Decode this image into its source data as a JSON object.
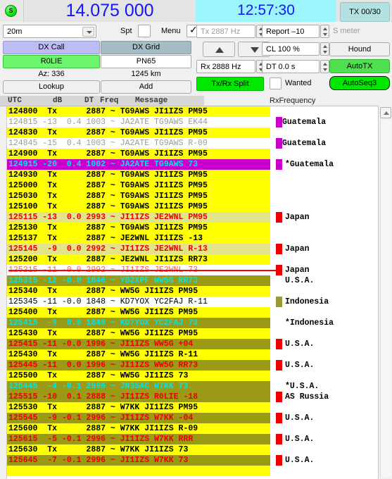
{
  "header": {
    "status_led": "S",
    "frequency": "14.075 000",
    "clock": "12:57:30",
    "tx_counter": "TX 00/30"
  },
  "controls": {
    "band": "20m",
    "spt_label": "Spt",
    "spt_checked": false,
    "menu_label": "Menu",
    "menu_checked": true,
    "dx_call_label": "DX Call",
    "dx_grid_label": "DX Grid",
    "dx_call_value": "R0LIE",
    "dx_grid_value": "PN65",
    "azimuth": "Az: 336",
    "distance": "1245 km",
    "lookup_label": "Lookup",
    "add_label": "Add",
    "tx_freq": "Tx  2887  Hz",
    "rx_freq": "Rx  2888  Hz",
    "up_arrow": "▲",
    "down_arrow": "▼",
    "report": "Report –10",
    "cl": "CL  100 %",
    "dt": "DT 0.0 s",
    "s_meter": "S meter",
    "hound": "Hound",
    "auto_tx": "AutoTX",
    "auto_seq": "AutoSeq3",
    "tx_rx_split": "Tx/Rx Split",
    "wanted_label": "Wanted",
    "wanted_checked": false
  },
  "table": {
    "columns": [
      "UTC",
      "dB",
      "DT",
      "Freq",
      "Message"
    ],
    "rx_frequency_label": "RxFrequency",
    "rows": [
      {
        "utc": "124800",
        "db": "Tx",
        "dt": "",
        "freq": "2887",
        "sep": "~",
        "msg": "TG9AWS JI1IZS PM95",
        "country": "",
        "style": "tx"
      },
      {
        "utc": "124815",
        "db": "-13",
        "dt": "0.4",
        "freq": "1003",
        "sep": "~",
        "msg": "JA2ATE TG9AWS EK44",
        "country": "Guatemala",
        "star": "^",
        "style": "gray",
        "mark": "#cc00cc"
      },
      {
        "utc": "124830",
        "db": "Tx",
        "dt": "",
        "freq": "2887",
        "sep": "~",
        "msg": "TG9AWS JI1IZS PM95",
        "country": "",
        "style": "tx"
      },
      {
        "utc": "124845",
        "db": "-15",
        "dt": "0.4",
        "freq": "1003",
        "sep": "~",
        "msg": "JA2ATE TG9AWS R-09",
        "country": "Guatemala",
        "star": "^",
        "style": "gray",
        "mark": "#cc00cc"
      },
      {
        "utc": "124900",
        "db": "Tx",
        "dt": "",
        "freq": "2887",
        "sep": "~",
        "msg": "TG9AWS JI1IZS PM95",
        "country": "",
        "style": "tx"
      },
      {
        "utc": "124915",
        "db": "-20",
        "dt": "0.4",
        "freq": "1002",
        "sep": "~",
        "msg": "JA2ATE TG9AWS 73",
        "country": "*Guatemala",
        "style": "magenta",
        "mark": "#cc00cc"
      },
      {
        "utc": "124930",
        "db": "Tx",
        "dt": "",
        "freq": "2887",
        "sep": "~",
        "msg": "TG9AWS JI1IZS PM95",
        "country": "",
        "style": "tx"
      },
      {
        "utc": "125000",
        "db": "Tx",
        "dt": "",
        "freq": "2887",
        "sep": "~",
        "msg": "TG9AWS JI1IZS PM95",
        "country": "",
        "style": "tx"
      },
      {
        "utc": "125030",
        "db": "Tx",
        "dt": "",
        "freq": "2887",
        "sep": "~",
        "msg": "TG9AWS JI1IZS PM95",
        "country": "",
        "style": "tx"
      },
      {
        "utc": "125100",
        "db": "Tx",
        "dt": "",
        "freq": "2887",
        "sep": "~",
        "msg": "TG9AWS JI1IZS PM95",
        "country": "",
        "style": "tx"
      },
      {
        "utc": "125115",
        "db": "-13",
        "dt": "0.0",
        "freq": "2993",
        "sep": "~",
        "msg": "JI1IZS JE2WNL PM95",
        "country": "Japan",
        "style": "khaki",
        "mark": "#ee0000"
      },
      {
        "utc": "125130",
        "db": "Tx",
        "dt": "",
        "freq": "2887",
        "sep": "~",
        "msg": "TG9AWS JI1IZS PM95",
        "country": "",
        "style": "tx"
      },
      {
        "utc": "125137",
        "db": "Tx",
        "dt": "",
        "freq": "2887",
        "sep": "~",
        "msg": "JE2WNL JI1IZS -13",
        "country": "",
        "style": "tx"
      },
      {
        "utc": "125145",
        "db": "-9",
        "dt": "0.0",
        "freq": "2992",
        "sep": "~",
        "msg": "JI1IZS JE2WNL R-13",
        "country": "Japan",
        "style": "khaki",
        "mark": "#ee0000"
      },
      {
        "utc": "125200",
        "db": "Tx",
        "dt": "",
        "freq": "2887",
        "sep": "~",
        "msg": "JE2WNL JI1IZS RR73",
        "country": "",
        "style": "tx"
      },
      {
        "utc": "125215",
        "db": "-11",
        "dt": "-0.0",
        "freq": "2992",
        "sep": "~",
        "msg": "JI1IZS JE2WNL 73",
        "country": "Japan",
        "style": "struck",
        "mark": "#ee0000"
      },
      {
        "utc": "125315",
        "db": "-12",
        "dt": "-0.0",
        "freq": "1846",
        "sep": "~",
        "msg": "YB2XPF WW5G RR73",
        "country": "U.S.A.",
        "style": "olive-cyan"
      },
      {
        "utc": "125340",
        "db": "Tx",
        "dt": "",
        "freq": "2887",
        "sep": "~",
        "msg": "WW5G JI1IZS PM95",
        "country": "",
        "style": "tx"
      },
      {
        "utc": "125345",
        "db": "-11",
        "dt": "-0.0",
        "freq": "1848",
        "sep": "~",
        "msg": "KD7YOX YC2FAJ R-11",
        "country": "Indonesia",
        "style": "plain",
        "mark": "#9a9a33"
      },
      {
        "utc": "125400",
        "db": "Tx",
        "dt": "",
        "freq": "2887",
        "sep": "~",
        "msg": "WW5G JI1IZS PM95",
        "country": "",
        "style": "tx"
      },
      {
        "utc": "125415",
        "db": "-9",
        "dt": "0.0",
        "freq": "1849",
        "sep": "~",
        "msg": "KD7YOX YC2FAJ 73",
        "country": "*Indonesia",
        "style": "olive-cyan"
      },
      {
        "utc": "125430",
        "db": "Tx",
        "dt": "",
        "freq": "2887",
        "sep": "~",
        "msg": "WW5G JI1IZS PM95",
        "country": "",
        "style": "tx"
      },
      {
        "utc": "125415",
        "db": "-11",
        "dt": "-0.0",
        "freq": "1996",
        "sep": "~",
        "msg": "JI1IZS WW5G +04",
        "country": "U.S.A.",
        "style": "olive-red",
        "mark": "#ee0000"
      },
      {
        "utc": "125430",
        "db": "Tx",
        "dt": "",
        "freq": "2887",
        "sep": "~",
        "msg": "WW5G JI1IZS R-11",
        "country": "",
        "style": "tx"
      },
      {
        "utc": "125445",
        "db": "-11",
        "dt": "0.0",
        "freq": "1996",
        "sep": "~",
        "msg": "JI1IZS WW5G RR73",
        "country": "U.S.A.",
        "style": "olive-red",
        "mark": "#ee0000"
      },
      {
        "utc": "125500",
        "db": "Tx",
        "dt": "",
        "freq": "2887",
        "sep": "~",
        "msg": "WW5G JI1IZS 73",
        "country": "",
        "style": "tx"
      },
      {
        "utc": "125445",
        "db": "-4",
        "dt": "-0.1",
        "freq": "2996",
        "sep": "~",
        "msg": "JN3SAC W7KK 73",
        "country": "*U.S.A.",
        "style": "olive-cyan"
      },
      {
        "utc": "125515",
        "db": "-10",
        "dt": "0.1",
        "freq": "2888",
        "sep": "~",
        "msg": "JI1IZS R0LIE -18",
        "country": "AS Russia",
        "style": "olive-red",
        "mark": "#ee0000"
      },
      {
        "utc": "125530",
        "db": "Tx",
        "dt": "",
        "freq": "2887",
        "sep": "~",
        "msg": "W7KK JI1IZS PM95",
        "country": "",
        "style": "tx"
      },
      {
        "utc": "125545",
        "db": "-9",
        "dt": "-0.1",
        "freq": "2996",
        "sep": "~",
        "msg": "JI1IZS W7KK -04",
        "country": "U.S.A.",
        "style": "olive-red",
        "mark": "#ee0000"
      },
      {
        "utc": "125600",
        "db": "Tx",
        "dt": "",
        "freq": "2887",
        "sep": "~",
        "msg": "W7KK JI1IZS R-09",
        "country": "",
        "style": "tx"
      },
      {
        "utc": "125615",
        "db": "-5",
        "dt": "-0.1",
        "freq": "2996",
        "sep": "~",
        "msg": "JI1IZS W7KK RRR",
        "country": "U.S.A.",
        "style": "olive-red",
        "mark": "#ee0000"
      },
      {
        "utc": "125630",
        "db": "Tx",
        "dt": "",
        "freq": "2887",
        "sep": "~",
        "msg": "W7KK JI1IZS 73",
        "country": "",
        "style": "tx"
      },
      {
        "utc": "125645",
        "db": "-7",
        "dt": "-0.1",
        "freq": "2996",
        "sep": "~",
        "msg": "JI1IZS W7KK 73",
        "country": "U.S.A.",
        "style": "olive-red",
        "mark": "#ee0000"
      },
      {
        "utc": "",
        "db": "",
        "dt": "",
        "freq": "",
        "sep": "",
        "msg": "",
        "country": "",
        "style": "tx"
      }
    ]
  },
  "colors": {
    "tx_bg": "#ffff00",
    "olive_bg": "#9a9a16",
    "khaki_bg": "#e3e38a",
    "magenta_bg": "#cc00cc",
    "cyan_text": "#00e5e5",
    "red_text": "#ee0000",
    "gray_text": "#9b9b9b",
    "clock_bg": "#9cf5fa",
    "accent_blue": "#1414ff"
  }
}
